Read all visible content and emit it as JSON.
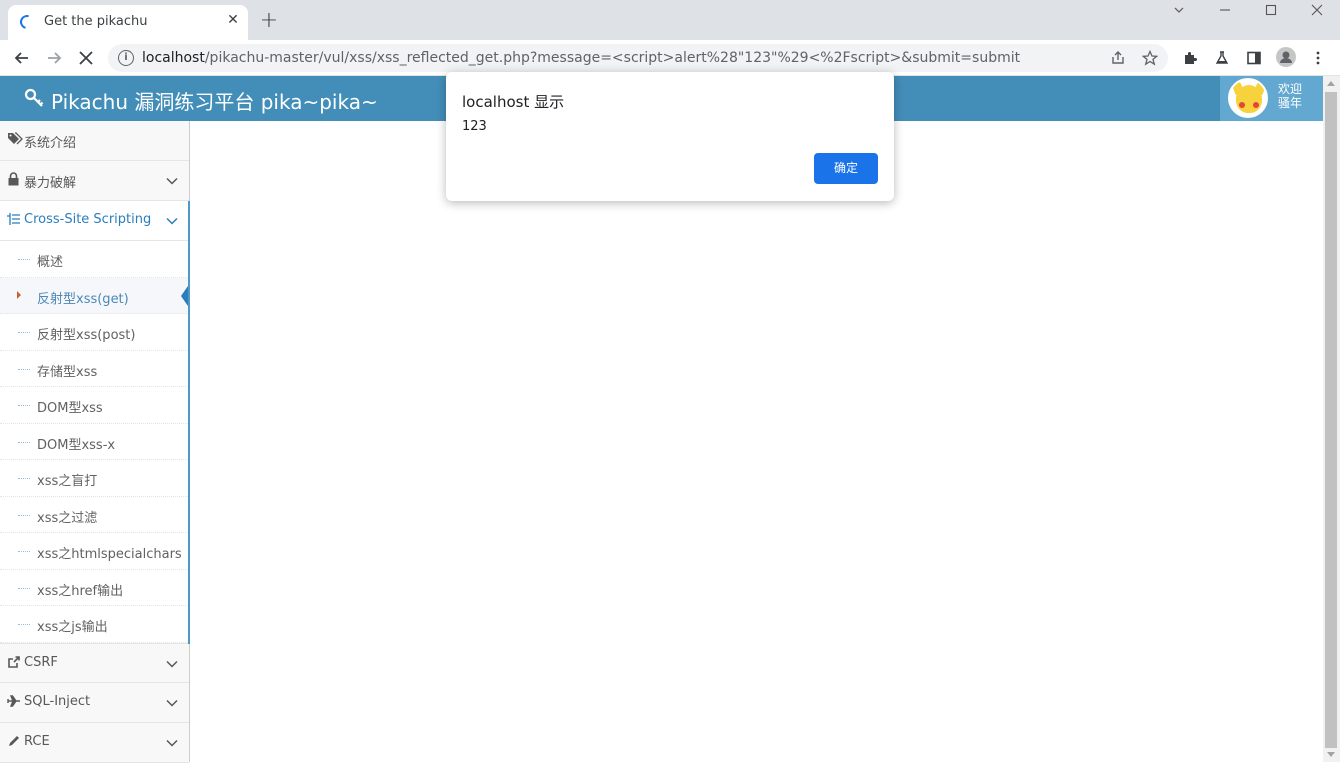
{
  "browser": {
    "tab_title": "Get the pikachu",
    "tab_close": "✕",
    "new_tab": "+",
    "url_host": "localhost",
    "url_rest": "/pikachu-master/vul/xss/xss_reflected_get.php?message=<script>alert%28\"123\"%29<%2Fscript>&submit=submit",
    "icons": {
      "back": "back-arrow-icon",
      "forward": "forward-arrow-icon",
      "reload": "stop-loading-icon",
      "info": "site-info-icon",
      "share": "share-icon",
      "bookmark": "star-icon",
      "extensions": "puzzle-icon",
      "labs": "flask-icon",
      "sidepanel": "side-panel-icon",
      "profile": "profile-icon",
      "menu": "kebab-menu-icon"
    }
  },
  "header": {
    "brand": "Pikachu 漏洞练习平台 pika~pika~",
    "welcome_line1": "欢迎",
    "welcome_line2": "骚年",
    "accent": "#438eb9"
  },
  "sidebar": {
    "items": [
      {
        "label": "系统介绍",
        "icon": "tags-icon",
        "has_chevron": false
      },
      {
        "label": "暴力破解",
        "icon": "lock-icon",
        "has_chevron": true
      },
      {
        "label": "Cross-Site Scripting",
        "icon": "list-icon",
        "has_chevron": true,
        "active": true
      },
      {
        "label": "CSRF",
        "icon": "share-square-icon",
        "has_chevron": true
      },
      {
        "label": "SQL-Inject",
        "icon": "plane-icon",
        "has_chevron": true
      },
      {
        "label": "RCE",
        "icon": "pencil-icon",
        "has_chevron": true
      }
    ],
    "sub_items": [
      "概述",
      "反射型xss(get)",
      "反射型xss(post)",
      "存储型xss",
      "DOM型xss",
      "DOM型xss-x",
      "xss之盲打",
      "xss之过滤",
      "xss之htmlspecialchars",
      "xss之href输出",
      "xss之js输出"
    ],
    "current_sub": "反射型xss(get)"
  },
  "dialog": {
    "title": "localhost 显示",
    "message": "123",
    "ok_label": "确定",
    "ok_color": "#1a73e8"
  }
}
